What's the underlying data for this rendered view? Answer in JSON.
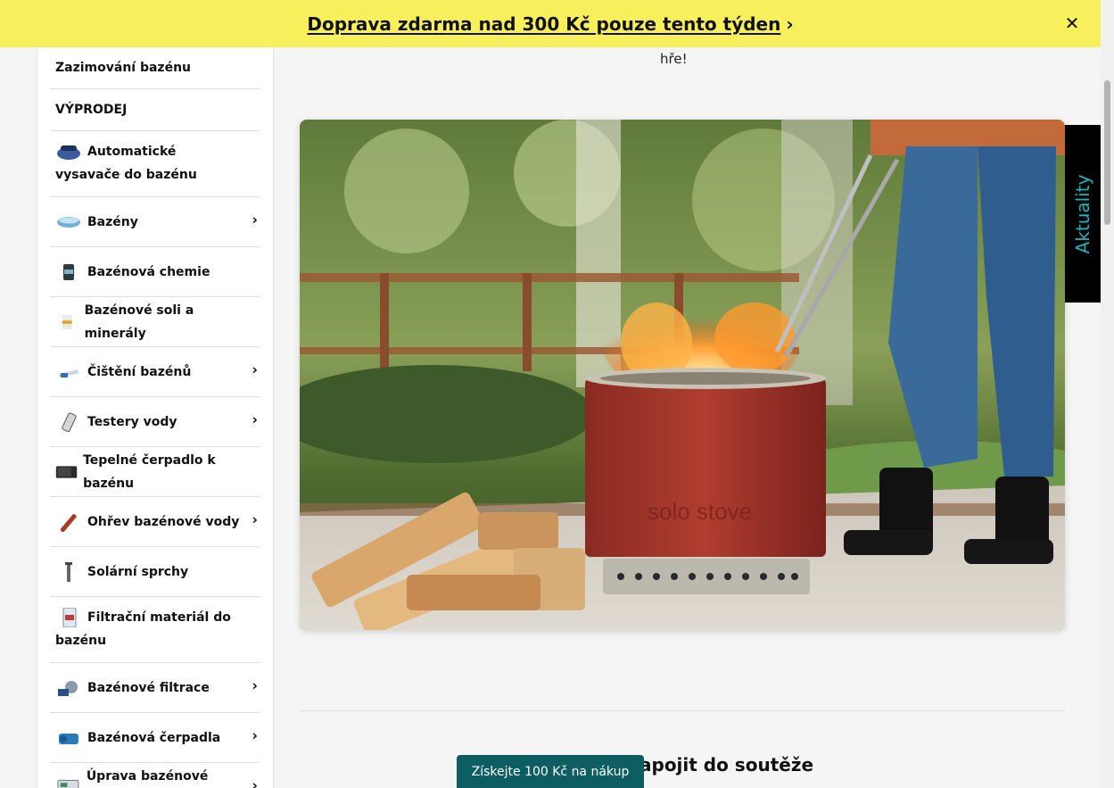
{
  "promo": {
    "text": "Doprava zdarma nad 300 Kč pouze tento týden",
    "arrow": "›",
    "close": "✕"
  },
  "main": {
    "intro_tail": "hře!",
    "section_title": "apojit do soutěže"
  },
  "cta": {
    "label": "Získejte 100 Kč na nákup"
  },
  "news_tab": {
    "label": "Aktuality"
  },
  "sidebar": {
    "items": [
      {
        "label": "Zazimování bazénu"
      },
      {
        "label": "VÝPRODEJ"
      },
      {
        "label": "Automatické vysavače do bazénu"
      },
      {
        "label": "Bazény"
      },
      {
        "label": "Bazénová chemie"
      },
      {
        "label": "Bazénové soli a minerály"
      },
      {
        "label": "Čištění bazénů"
      },
      {
        "label": "Testery vody"
      },
      {
        "label": "Tepelné čerpadlo k bazénu"
      },
      {
        "label": "Ohřev bazénové vody"
      },
      {
        "label": "Solární sprchy"
      },
      {
        "label": "Filtrační materiál do bazénu"
      },
      {
        "label": "Bazénové filtrace"
      },
      {
        "label": "Bazénová čerpadla"
      },
      {
        "label": "Úprava bazénové vody"
      }
    ],
    "chevron": "›"
  },
  "hero": {
    "brand_mark": "solo stove"
  },
  "colors": {
    "promo_bg": "#f8ef5c",
    "cta_bg": "#0d5e63",
    "news_tab_bg": "#000000",
    "news_tab_text": "#1fb5c0"
  }
}
